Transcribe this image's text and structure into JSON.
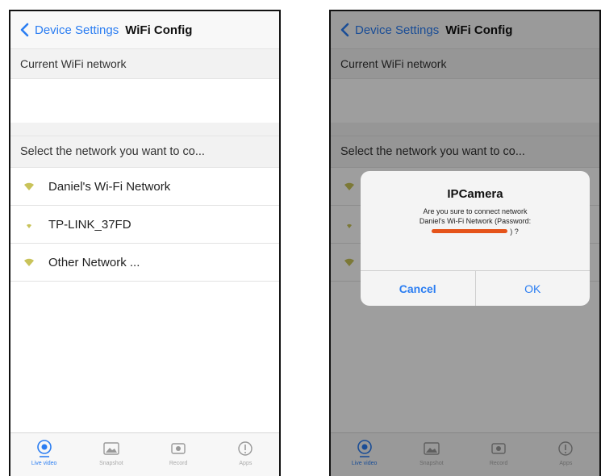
{
  "nav": {
    "back_label": "Device Settings",
    "title": "WiFi Config"
  },
  "sections": {
    "current_header": "Current WiFi network",
    "select_header": "Select the network you want to co..."
  },
  "networks": [
    {
      "label": "Daniel's Wi-Fi Network",
      "icon": "wifi-icon"
    },
    {
      "label": "TP-LINK_37FD",
      "icon": "wifi-icon"
    },
    {
      "label": "Other Network ...",
      "icon": "wifi-icon"
    }
  ],
  "tabs": [
    {
      "label": "Live video",
      "icon": "live-video-icon"
    },
    {
      "label": "Snapshot",
      "icon": "snapshot-icon"
    },
    {
      "label": "Record",
      "icon": "record-icon"
    },
    {
      "label": "Apps",
      "icon": "info-icon"
    }
  ],
  "dialog": {
    "title": "IPCamera",
    "message_line1": "Are you sure to connect network",
    "message_line2": "Daniel's Wi-Fi Network (Password:",
    "message_suffix": ") ?",
    "cancel_label": "Cancel",
    "ok_label": "OK"
  },
  "colors": {
    "accent": "#2a7df2",
    "wifi_icon": "#c9c35a",
    "redaction": "#e5531a",
    "header_bg": "#f2f2f2"
  }
}
